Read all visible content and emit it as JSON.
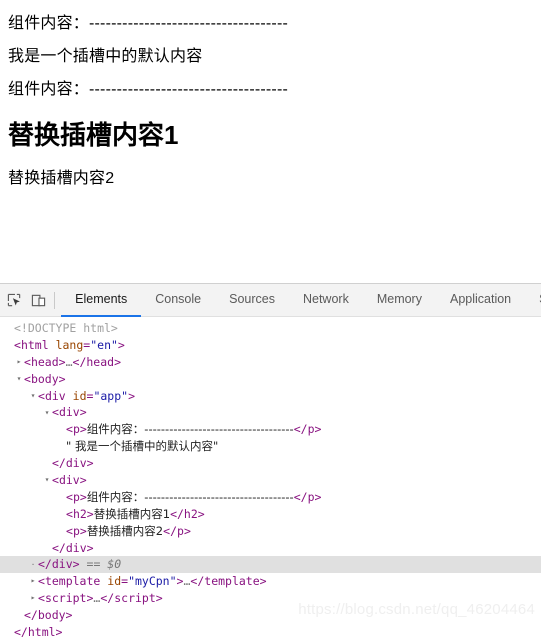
{
  "page": {
    "lines": [
      {
        "type": "p",
        "text": "组件内容：------------------------------------"
      },
      {
        "type": "p",
        "text": "我是一个插槽中的默认内容"
      },
      {
        "type": "p",
        "text": "组件内容：------------------------------------"
      },
      {
        "type": "h2",
        "text": "替换插槽内容1"
      },
      {
        "type": "p",
        "text": "替换插槽内容2"
      }
    ]
  },
  "devtools": {
    "toolbar": {
      "inspect_icon": "inspect-element-icon",
      "device_icon": "device-toolbar-icon"
    },
    "tabs": [
      {
        "label": "Elements",
        "active": true
      },
      {
        "label": "Console",
        "active": false
      },
      {
        "label": "Sources",
        "active": false
      },
      {
        "label": "Network",
        "active": false
      },
      {
        "label": "Memory",
        "active": false
      },
      {
        "label": "Application",
        "active": false
      },
      {
        "label": "Security",
        "active": false
      }
    ],
    "dom": {
      "doctype": "<!DOCTYPE html>",
      "html_open_tag": "<html lang=\"en\">",
      "html_tag": "html",
      "html_attr_name": "lang",
      "html_attr_value": "\"en\"",
      "head_collapsed": "<head>…</head>",
      "body_open": "<body>",
      "div_app_tag": "div",
      "div_app_attr_name": "id",
      "div_app_attr_value": "\"app\"",
      "p1_text": "组件内容：------------------------------------",
      "slot_default_text": "\" 我是一个插槽中的默认内容\"",
      "p2_text": "组件内容：------------------------------------",
      "h2_text": "替换插槽内容1",
      "p3_text": "替换插槽内容2",
      "selected_suffix": "== $0",
      "template_tag": "template",
      "template_attr_name": "id",
      "template_attr_value": "\"myCpn\"",
      "script_tag": "script",
      "body_close": "</body>",
      "html_close": "</html>",
      "div_close": "</div>",
      "ellipsis": "…"
    }
  },
  "watermark": "https://blog.csdn.net/qq_46204464"
}
